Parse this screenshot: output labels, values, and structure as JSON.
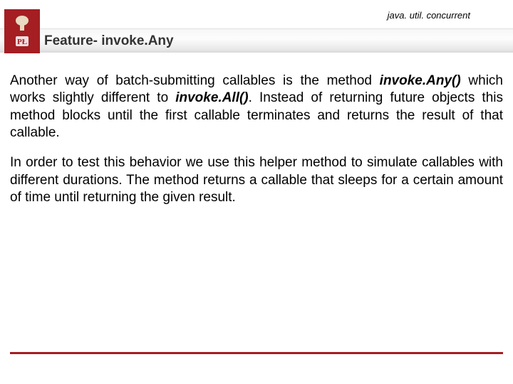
{
  "header": {
    "package": "java. util. concurrent",
    "title": "Feature- invoke.Any",
    "logo_letters": "P  Ł"
  },
  "body": {
    "p1a": "Another way of batch-submitting callables is the method ",
    "p1b": "invoke.Any()",
    "p1c": " which works slightly different to ",
    "p1d": "invoke.All()",
    "p1e": ". Instead of returning future objects this method blocks until the first callable terminates and returns the result of that callable.",
    "p2": "In order to test this behavior we use this helper method to simulate callables with different durations. The method returns a callable that sleeps for a certain amount of time until returning the given result."
  },
  "colors": {
    "brand": "#a41e22"
  }
}
